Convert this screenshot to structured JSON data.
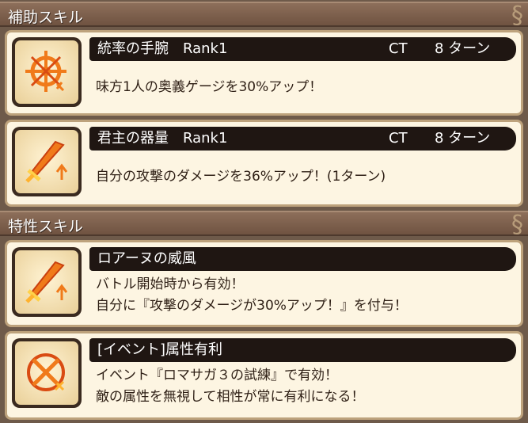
{
  "sections": [
    {
      "title": "補助スキル"
    },
    {
      "title": "特性スキル"
    }
  ],
  "support_skills": [
    {
      "icon": "target-crosshair-icon",
      "name": "統率の手腕　Rank1",
      "ct_label": "CT",
      "ct_value": "8 ターン",
      "desc": [
        "味方1人の奥義ゲージを30%アップ！"
      ]
    },
    {
      "icon": "sword-arrow-icon",
      "name": "君主の器量　Rank1",
      "ct_label": "CT",
      "ct_value": "8 ターン",
      "desc": [
        "自分の攻撃のダメージを36%アップ！(1ターン)"
      ]
    }
  ],
  "trait_skills": [
    {
      "icon": "sword-arrow-icon",
      "name": "ロアーヌの威風",
      "desc": [
        "バトル開始時から有効！",
        "自分に『攻撃のダメージが30%アップ！』を付与！"
      ]
    },
    {
      "icon": "crossed-arrow-icon",
      "name": "[イベント]属性有利",
      "desc": [
        "イベント『ロマサガ３の試練』で有効！",
        "敵の属性を無視して相性が常に有利になる！"
      ]
    }
  ],
  "colors": {
    "bar": "#1f1612",
    "card_bg": "#fdf5e2",
    "icon_orange": "#f07a1a"
  }
}
